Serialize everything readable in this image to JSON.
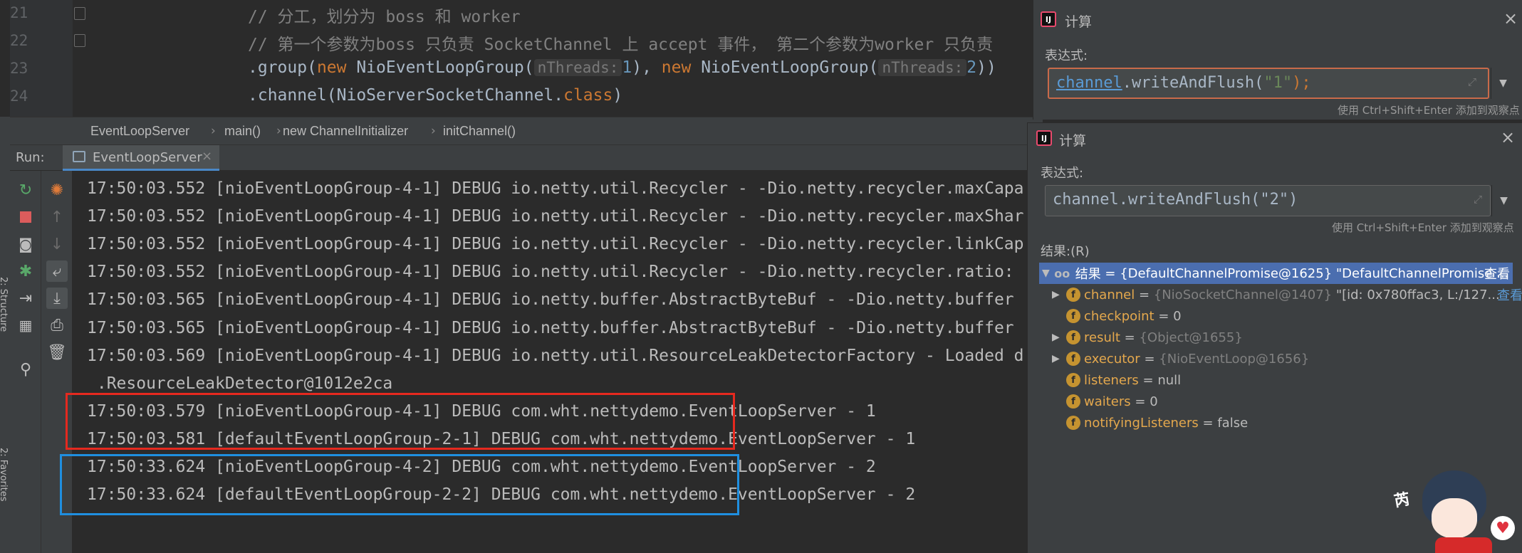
{
  "editor": {
    "lines": [
      {
        "num": "21",
        "parts": [
          {
            "t": "// 分工，划分为 boss 和 worker",
            "c": "cmt"
          }
        ]
      },
      {
        "num": "22",
        "parts": [
          {
            "t": "// 第一个参数为boss 只负责 SocketChannel 上 accept 事件， 第二个参数为worker 只负责",
            "c": "cmt"
          }
        ]
      },
      {
        "num": "23",
        "parts": [
          {
            "t": ".group(",
            "c": ""
          },
          {
            "t": "new",
            "c": "kw"
          },
          {
            "t": " NioEventLoopGroup(",
            "c": ""
          },
          {
            "t": "nThreads:",
            "c": "hint"
          },
          {
            "t": "1",
            "c": "num"
          },
          {
            "t": "), ",
            "c": ""
          },
          {
            "t": "new",
            "c": "kw"
          },
          {
            "t": " NioEventLoopGroup(",
            "c": ""
          },
          {
            "t": "nThreads:",
            "c": "hint"
          },
          {
            "t": "2",
            "c": "num"
          },
          {
            "t": "))",
            "c": ""
          }
        ]
      },
      {
        "num": "24",
        "parts": [
          {
            "t": ".channel(NioServerSocketChannel.",
            "c": ""
          },
          {
            "t": "class",
            "c": "kw"
          },
          {
            "t": ")",
            "c": ""
          }
        ]
      }
    ]
  },
  "breadcrumb": [
    "EventLoopServer",
    "main()",
    "new ChannelInitializer",
    "initChannel()"
  ],
  "run": {
    "label": "Run:",
    "tab": "EventLoopServer"
  },
  "side_labels": {
    "structure": "2: Structure",
    "favorites": "2: Favorites"
  },
  "console": {
    "lines": [
      "17:50:03.552 [nioEventLoopGroup-4-1] DEBUG io.netty.util.Recycler - -Dio.netty.recycler.maxCapa",
      "17:50:03.552 [nioEventLoopGroup-4-1] DEBUG io.netty.util.Recycler - -Dio.netty.recycler.maxShar",
      "17:50:03.552 [nioEventLoopGroup-4-1] DEBUG io.netty.util.Recycler - -Dio.netty.recycler.linkCap",
      "17:50:03.552 [nioEventLoopGroup-4-1] DEBUG io.netty.util.Recycler - -Dio.netty.recycler.ratio:",
      "17:50:03.565 [nioEventLoopGroup-4-1] DEBUG io.netty.buffer.AbstractByteBuf - -Dio.netty.buffer",
      "17:50:03.565 [nioEventLoopGroup-4-1] DEBUG io.netty.buffer.AbstractByteBuf - -Dio.netty.buffer",
      "17:50:03.569 [nioEventLoopGroup-4-1] DEBUG io.netty.util.ResourceLeakDetectorFactory - Loaded d",
      " .ResourceLeakDetector@1012e2ca",
      "17:50:03.579 [nioEventLoopGroup-4-1] DEBUG com.wht.nettydemo.EventLoopServer - 1",
      "17:50:03.581 [defaultEventLoopGroup-2-1] DEBUG com.wht.nettydemo.EventLoopServer - 1",
      "17:50:33.624 [nioEventLoopGroup-4-2] DEBUG com.wht.nettydemo.EventLoopServer - 2",
      "17:50:33.624 [defaultEventLoopGroup-2-2] DEBUG com.wht.nettydemo.EventLoopServer - 2"
    ],
    "highlight_colors": {
      "group1": "#e5291f",
      "group2": "#1f8fe0"
    }
  },
  "eval1": {
    "title": "计算",
    "expr_label": "表达式:",
    "expr_var": "channel",
    "expr_rest": ".writeAndFlush(",
    "expr_str": "\"1\"",
    "expr_end": ");",
    "hint": "使用 Ctrl+Shift+Enter 添加到观察点"
  },
  "eval2": {
    "title": "计算",
    "expr_label": "表达式:",
    "expr": "channel.writeAndFlush(\"2\")",
    "hint": "使用 Ctrl+Shift+Enter 添加到观察点",
    "result_label": "结果:(R)",
    "tree": [
      {
        "expand": "▼",
        "icon": "oo",
        "name": "结果",
        "eq": " = ",
        "obj": "{DefaultChannelPromise@1625}",
        "val": " \"DefaultChannelPromise ... ",
        "look": "查看",
        "selected": true
      },
      {
        "expand": "▶",
        "icon": "f",
        "name": "channel",
        "eq": " = ",
        "obj": "{NioSocketChannel@1407}",
        "val": " \"[id: 0x780ffac3, L:/127... ",
        "look": "查看"
      },
      {
        "expand": "",
        "icon": "f",
        "name": "checkpoint",
        "eq": " = ",
        "obj": "",
        "val": "0",
        "look": ""
      },
      {
        "expand": "▶",
        "icon": "f",
        "name": "result",
        "eq": " = ",
        "obj": "{Object@1655}",
        "val": "",
        "look": ""
      },
      {
        "expand": "▶",
        "icon": "f",
        "name": "executor",
        "eq": " = ",
        "obj": "{NioEventLoop@1656}",
        "val": "",
        "look": ""
      },
      {
        "expand": "",
        "icon": "f",
        "name": "listeners",
        "eq": " = ",
        "obj": "",
        "val": "null",
        "look": ""
      },
      {
        "expand": "",
        "icon": "f",
        "name": "waiters",
        "eq": " = ",
        "obj": "",
        "val": "0",
        "look": ""
      },
      {
        "expand": "",
        "icon": "f",
        "name": "notifyingListeners",
        "eq": " = ",
        "obj": "",
        "val": "false",
        "look": ""
      }
    ]
  },
  "mascot_glyph": "芮"
}
